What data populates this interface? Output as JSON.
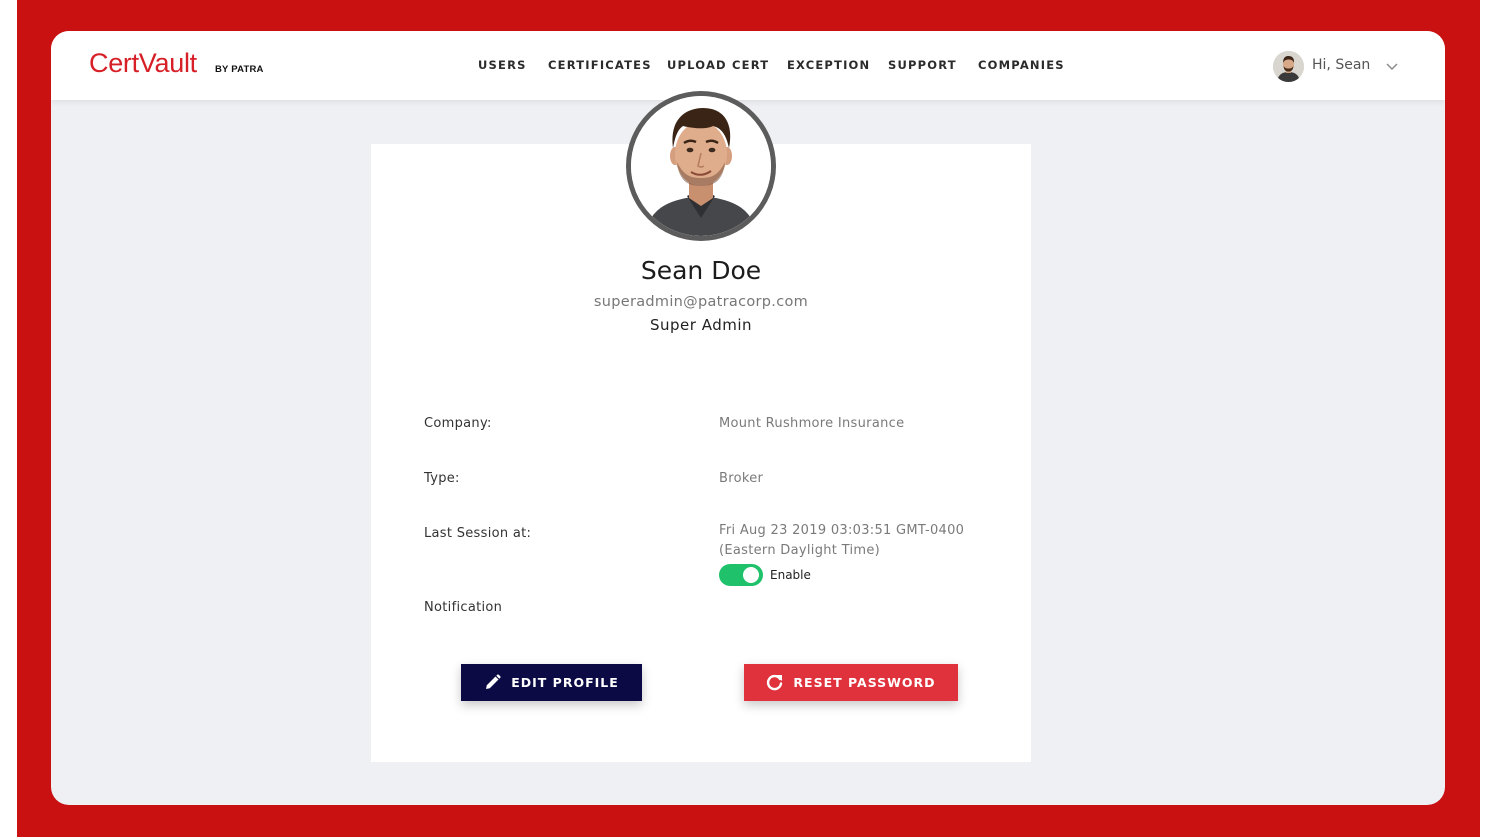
{
  "brand": {
    "name": "CertVault",
    "byline": "BY PATRA",
    "color": "#d61f26"
  },
  "nav": {
    "items": [
      "USERS",
      "CERTIFICATES",
      "UPLOAD CERT",
      "EXCEPTION",
      "SUPPORT",
      "COMPANIES"
    ]
  },
  "user_menu": {
    "greeting": "Hi, Sean",
    "avatar_icon": "user-avatar",
    "dropdown_icon": "chevron-down-icon"
  },
  "profile": {
    "name": "Sean Doe",
    "email": "superadmin@patracorp.com",
    "role": "Super Admin",
    "fields": [
      {
        "label": "Company:",
        "value": "Mount Rushmore Insurance"
      },
      {
        "label": "Type:",
        "value": "Broker"
      },
      {
        "label": "Last Session at:",
        "value_line1": "Fri Aug 23 2019 03:03:51 GMT-0400",
        "value_line2": "(Eastern Daylight Time)"
      }
    ],
    "notification": {
      "label": "Notification",
      "toggle_label": "Enable",
      "enabled": true,
      "toggle_color": "#1fc26b"
    }
  },
  "actions": {
    "edit_label": "EDIT PROFILE",
    "edit_icon": "pencil-icon",
    "edit_color": "#0b0a45",
    "reset_label": "RESET PASSWORD",
    "reset_icon": "refresh-icon",
    "reset_color": "#e0323c"
  },
  "colors": {
    "frame": "#c91111",
    "page_background": "#eff0f4"
  }
}
